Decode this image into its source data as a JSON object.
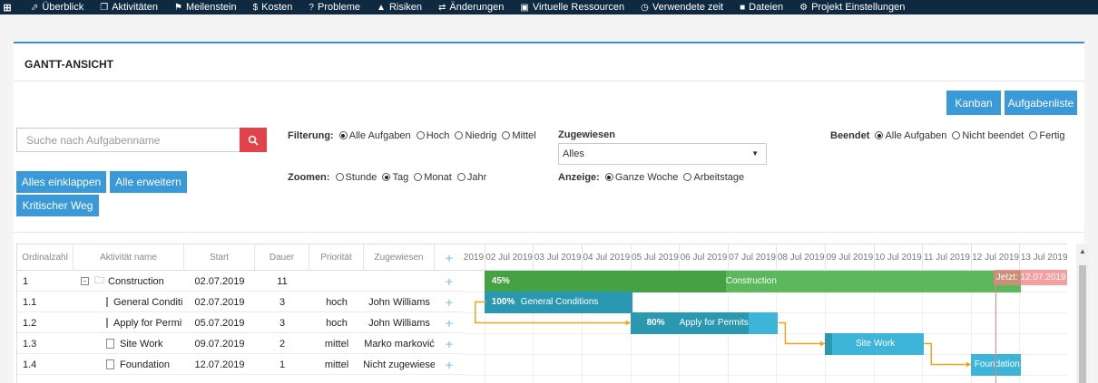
{
  "topnav": {
    "plus_icon": "plus-square-icon",
    "items": [
      {
        "icon": "chart-line-icon",
        "glyph": "⬀",
        "label": "Überblick"
      },
      {
        "icon": "copy-icon",
        "glyph": "❐",
        "label": "Aktivitäten"
      },
      {
        "icon": "flag-icon",
        "glyph": "⚑",
        "label": "Meilenstein"
      },
      {
        "icon": "dollar-icon",
        "glyph": "$",
        "label": "Kosten"
      },
      {
        "icon": "question-circle-icon",
        "glyph": "?",
        "label": "Probleme"
      },
      {
        "icon": "warning-icon",
        "glyph": "▲",
        "label": "Risiken"
      },
      {
        "icon": "exchange-icon",
        "glyph": "⇄",
        "label": "Änderungen"
      },
      {
        "icon": "briefcase-icon",
        "glyph": "▣",
        "label": "Virtuelle Ressourcen"
      },
      {
        "icon": "clock-icon",
        "glyph": "◷",
        "label": "Verwendete zeit"
      },
      {
        "icon": "folder-icon",
        "glyph": "■",
        "label": "Dateien"
      },
      {
        "icon": "gears-icon",
        "glyph": "⚙",
        "label": "Projekt Einstellungen"
      }
    ]
  },
  "panel": {
    "title": "GANTT-ANSICHT",
    "kanban": "Kanban",
    "task_list": "Aufgabenliste",
    "search_placeholder": "Suche nach Aufgabenname",
    "collapse_all": "Alles einklappen",
    "expand_all": "Alle erweitern",
    "critical_path": "Kritischer Weg"
  },
  "filters": {
    "filter_label": "Filterung:",
    "filter_options": [
      "Alle Aufgaben",
      "Hoch",
      "Niedrig",
      "Mittel"
    ],
    "filter_selected": "Alle Aufgaben",
    "zoom_label": "Zoomen:",
    "zoom_options": [
      "Stunde",
      "Tag",
      "Monat",
      "Jahr"
    ],
    "zoom_selected": "Tag",
    "assigned_label": "Zugewiesen",
    "assigned_value": "Alles",
    "display_label": "Anzeige:",
    "display_options": [
      "Ganze Woche",
      "Arbeitstage"
    ],
    "display_selected": "Ganze Woche",
    "done_label": "Beendet",
    "done_options": [
      "Alle Aufgaben",
      "Nicht beendet",
      "Fertig"
    ],
    "done_selected": "Alle Aufgaben"
  },
  "grid": {
    "headers": [
      "Ordinalzahl",
      "Aktivität name",
      "Start",
      "Dauer",
      "Priorität",
      "Zugewiesen"
    ],
    "rows": [
      {
        "num": "1",
        "name": "Construction",
        "start": "02.07.2019",
        "dur": "11",
        "prio": "",
        "assignee": "",
        "type": "folder"
      },
      {
        "num": "1.1",
        "name": "General Conditic",
        "start": "02.07.2019",
        "dur": "3",
        "prio": "hoch",
        "assignee": "John Williams",
        "type": "file"
      },
      {
        "num": "1.2",
        "name": "Apply for Permit",
        "start": "05.07.2019",
        "dur": "3",
        "prio": "hoch",
        "assignee": "John Williams",
        "type": "file"
      },
      {
        "num": "1.3",
        "name": "Site Work",
        "start": "09.07.2019",
        "dur": "2",
        "prio": "mittel",
        "assignee": "Marko marković",
        "type": "file"
      },
      {
        "num": "1.4",
        "name": "Foundation",
        "start": "12.07.2019",
        "dur": "1",
        "prio": "mittel",
        "assignee": "Nicht zugewiese",
        "type": "file"
      }
    ]
  },
  "chart": {
    "days": [
      "2019",
      "02 Jul 2019",
      "03 Jul 2019",
      "04 Jul 2019",
      "05 Jul 2019",
      "06 Jul 2019",
      "07 Jul 2019",
      "08 Jul 2019",
      "09 Jul 2019",
      "10 Jul 2019",
      "11 Jul 2019",
      "12 Jul 2019",
      "13 Jul 2019"
    ],
    "now_label": "Jetzt: 12.07.2019",
    "bars": [
      {
        "name": "Construction",
        "progress_text": "45%",
        "progress": 0.45,
        "color": "#5cb85c",
        "dark": "#44a244"
      },
      {
        "name": "General Conditions",
        "progress_text": "100%",
        "progress": 1.0,
        "color": "#2a98b0",
        "dark": "#2a98b0"
      },
      {
        "name": "Apply for Permits",
        "progress_text": "80%",
        "progress": 0.8,
        "color": "#3cb5d8",
        "dark": "#2a98b0"
      },
      {
        "name": "Site Work",
        "progress_text": "",
        "progress": 0.0,
        "color": "#3cb5d8",
        "dark": "#2a98b0"
      },
      {
        "name": "Foundation",
        "progress_text": "",
        "progress": 0.0,
        "color": "#3cb5d8",
        "dark": "#2a98b0"
      }
    ],
    "link_color": "#f5a21b",
    "now_color": "#f08080"
  }
}
